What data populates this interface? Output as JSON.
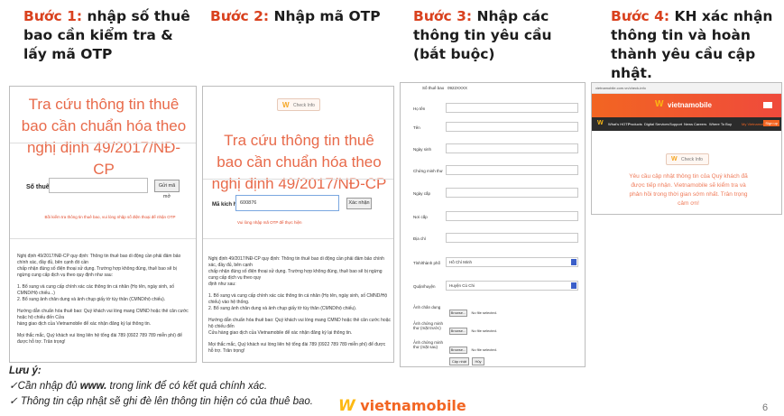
{
  "steps": [
    {
      "num": "Bước 1:",
      "text": " nhập số thuê bao cần kiểm tra & lấy mã OTP"
    },
    {
      "num": "Bước 2:",
      "text": " Nhập mã OTP"
    },
    {
      "num": "Bước 3:",
      "text": " Nhập các thông tin yêu cầu (bắt buộc)"
    },
    {
      "num": "Bước 4:",
      "text": " KH xác nhận thông tin và hoàn thành yêu cầu cập nhật."
    }
  ],
  "panel1": {
    "title": "Tra cứu thông tin thuê bao cần chuẩn hóa theo nghị định 49/2017/NĐ-CP",
    "field_label": "Số thuê bao",
    "button": "Gửi mã mở",
    "note": "Bồi kiểm tra thông tin thuê bao, vui lòng nhập số điện thoại để nhận OTP",
    "body_lines": [
      "Nghị định 49/2017/NĐ-CP quy định: Thông tin thuê bao di động cần phải đảm bảo chính xác, đầy đủ, bên cạnh đó cần",
      "chấp nhận đúng số điện thoại sử dụng. Trường hợp không đúng, thuê bao sẽ bị ngừng cung cấp dịch vụ theo quy định như sau:",
      "1. Bổ sung và cung cấp chính xác các thông tin cá nhân (Họ tên, ngày sinh, số CMND/Hộ chiếu...)",
      "2. Bổ sung ảnh chân dung và ảnh chụp giấy tờ tùy thân (CMND/hộ chiếu).",
      "Hướng dẫn chuẩn hóa thuê bao: Quý khách vui lòng mang CMND hoặc thẻ căn cước hoặc hộ chiếu đến Cửa",
      "hàng giao dịch của Vietnamobile để xác nhận đăng ký lại thông tin.",
      "Mọi thắc mắc, Quý khách vui lòng liên hệ tổng đài 789 (0922 789 789 miễn phí) để được hỗ trợ. Trân trọng!"
    ]
  },
  "panel2": {
    "tab_label": "Check Info",
    "title": "Tra cứu thông tin thuê bao cần chuẩn hóa theo nghị định 49/2017/NĐ-CP",
    "field_label": "Mã kích hoạt",
    "field_value": "600876",
    "button": "Xác nhận",
    "note": "Vui lòng nhập mã OTP để thực hiện",
    "body_lines": [
      "Nghị định 49/2017/NĐ-CP quy định: Thông tin thuê bao di động cần phải đảm bảo chính xác, đầy đủ, bên cạnh",
      "chấp nhận đúng số điện thoại sử dụng. Trường hợp không đúng, thuê bao sẽ bị ngừng cung cấp dịch vụ theo quy",
      "định như sau:",
      "1. Bổ sung và cung cấp chính xác các thông tin cá nhân (Họ tên, ngày sinh, số CMND/Hộ chiếu) vào hệ thống.",
      "2. Bổ sung ảnh chân dung và ảnh chụp giấy tờ tùy thân (CMND/hộ chiếu).",
      "Hướng dẫn chuẩn hóa thuê bao: Quý khách vui lòng mang CMND hoặc thẻ căn cước hoặc hộ chiếu đến",
      "Cửa hàng giao dịch của Vietnamobile để xác nhận đăng ký lại thông tin.",
      "Mọi thắc mắc, Quý khách vui lòng liên hệ tổng đài 789 (0922 789 789 miễn phí) để được hỗ trợ. Trân trọng!"
    ]
  },
  "panel3": {
    "top_label": "Số thuê bao",
    "top_value": "0922XXXX",
    "rows": [
      {
        "label": "Họ tên",
        "type": "text"
      },
      {
        "label": "Tên",
        "type": "text"
      },
      {
        "label": "Ngày sinh",
        "type": "text"
      },
      {
        "label": "Chứng minh thư",
        "type": "text"
      },
      {
        "label": "Ngày cấp",
        "type": "text"
      },
      {
        "label": "Nơi cấp",
        "type": "text"
      },
      {
        "label": "Địa chỉ",
        "type": "text"
      },
      {
        "label": "Tỉnh/thành phố",
        "type": "select",
        "value": "Hồ Chí Minh"
      },
      {
        "label": "Quận/huyện",
        "type": "select",
        "value": "Huyện Củ Chi"
      },
      {
        "label": "Ảnh chân dung",
        "type": "file"
      },
      {
        "label": "Ảnh chứng minh thư (mặt trước)",
        "type": "file"
      },
      {
        "label": "Ảnh chứng minh thư (mặt sau)",
        "type": "file"
      }
    ],
    "browse_label": "Browse...",
    "no_file_label": "No file selected.",
    "submit_label": "Cập nhật",
    "cancel_label": "Hủy"
  },
  "panel4": {
    "url_bar": "vietnamobile.com.vn/check-info",
    "brand": "vietnamobile",
    "nav": [
      "What's HOT?",
      "Products",
      "Digital Services",
      "Support",
      "News",
      "Careers",
      "Where To Buy"
    ],
    "nav_right": "My Vietnamobile",
    "nav_button": "Sign up",
    "tab_label": "Check Info",
    "message": "Yêu cầu cập nhật thông tin của Quý khách đã được tiếp nhận. Vietnamobile sẽ kiểm tra và phản hồi trong thời gian sớm nhất. Trân trọng cảm ơn!"
  },
  "notes": {
    "heading": "Lưu ý:",
    "line1_prefix": "✓Cần nhập đủ ",
    "line1_bold": "www.",
    "line1_suffix": " trong link để có kết quả chính xác.",
    "line2": "✓ Thông tin cập nhật sẽ ghi đè lên thông tin hiện có của thuê bao."
  },
  "footer": {
    "brand": "vietnamobile",
    "page_number": "6"
  },
  "colors": {
    "accent": "#d9411e",
    "brand_orange": "#f26522",
    "brand_yellow": "#fdb913",
    "nav_dark": "#2b2b2b",
    "title_pink": "#e86a4a"
  }
}
